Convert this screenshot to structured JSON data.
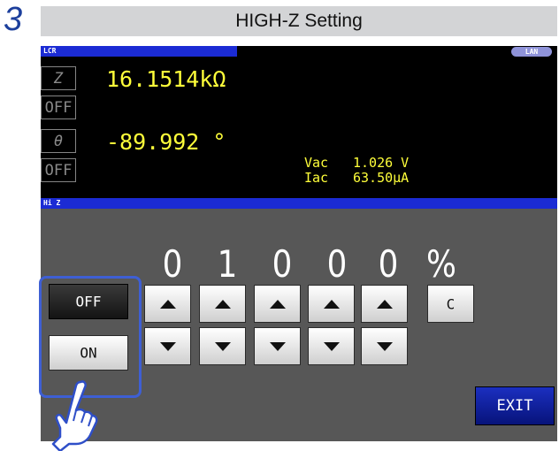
{
  "step_number": "3",
  "title": "HIGH-Z Setting",
  "screen": {
    "top_tab": "LCR",
    "lan_badge": "LAN",
    "param1_label": "Z",
    "param1_value": "16.1514kΩ",
    "param1_off": "OFF",
    "param2_label": "θ",
    "param2_value": "-89.992 °",
    "param2_off": "OFF",
    "monitor": {
      "vac_label": "Vac",
      "vac_value": "1.026 V",
      "iac_label": "Iac",
      "iac_value": "63.50µA"
    },
    "section_tab": "Hi Z",
    "digits": [
      "0",
      "1",
      "0",
      "0",
      "0"
    ],
    "unit": "%",
    "off_button": "OFF",
    "on_button": "ON",
    "clear_button": "C",
    "exit_button": "EXIT"
  },
  "colors": {
    "screen_bg": "#000000",
    "panel_bg": "#575757",
    "bar_blue": "#1b2bd4",
    "value_yellow": "#ffff3a",
    "highlight": "#3e5fd4",
    "exit_button_bg": "#0a1b9c"
  },
  "icons": [
    "up-arrow-icon",
    "down-arrow-icon",
    "pointing-hand-icon"
  ]
}
